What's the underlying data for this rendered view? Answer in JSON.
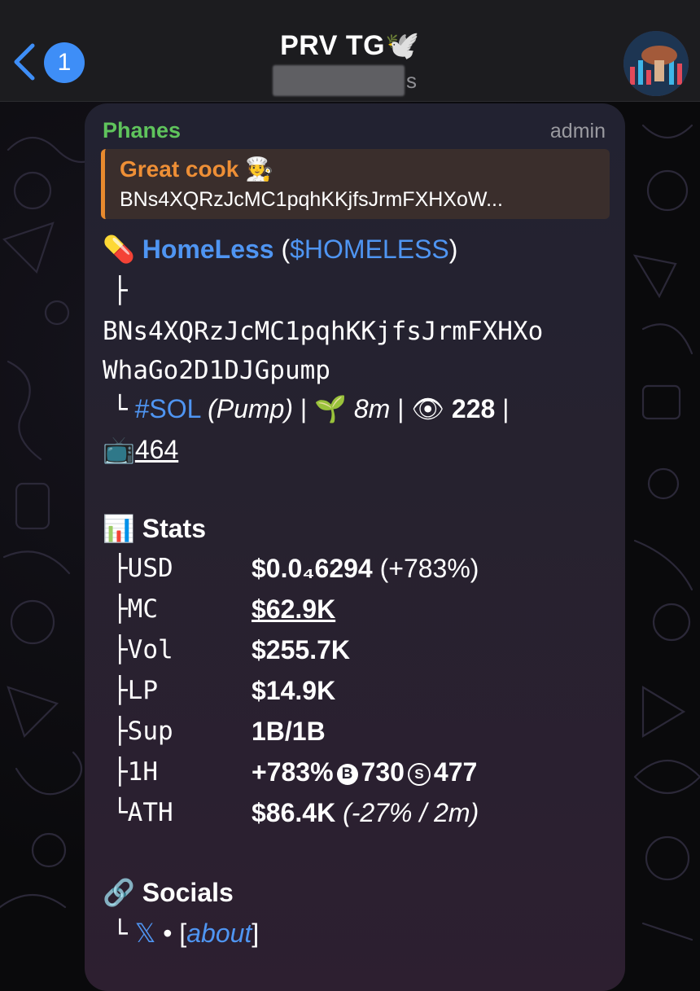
{
  "header": {
    "back_badge": "1",
    "title": "PRV TG",
    "title_emoji": "🕊️",
    "subtitle_visible_suffix": "s"
  },
  "message": {
    "sender": "Phanes",
    "role": "admin",
    "reply": {
      "title": "Great cook",
      "title_emoji": "🧑‍🍳",
      "text": "BNs4XQRzJcMC1pqhKKjfsJrmFXHXoW..."
    },
    "token": {
      "emoji": "💊",
      "name": "HomeLess",
      "open_paren": " (",
      "ticker": "$HOMELESS",
      "close_paren": ")",
      "tree_branch": "├",
      "address_line1": "BNs4XQRzJcMC1pqhKKjfsJrmFXHXo",
      "address_line2": "WhaGo2D1DJGpump",
      "tree_end": "└",
      "chain_tag": "#SOL",
      "platform": "(Pump)",
      "sep": " | ",
      "age_emoji": "🌱",
      "age": "8m",
      "views_emoji": "👁",
      "views": "228",
      "tv_emoji": "📺",
      "tv_count": "464"
    },
    "stats": {
      "emoji": "📊",
      "heading": "Stats",
      "rows": [
        {
          "branch": "├",
          "key": "USD",
          "value": "$0.0₄6294",
          "extra": " (+783%)"
        },
        {
          "branch": "├",
          "key": "MC",
          "value": "$62.9K",
          "extra": ""
        },
        {
          "branch": "├",
          "key": "Vol",
          "value": "$255.7K",
          "extra": ""
        },
        {
          "branch": "├",
          "key": "LP",
          "value": "$14.9K",
          "extra": ""
        },
        {
          "branch": "├",
          "key": "Sup",
          "value": "1B/1B",
          "extra": ""
        },
        {
          "branch": "├",
          "key": "1H",
          "value": "+783%",
          "buy_icon": "B",
          "buys": "730",
          "sell_icon": "S",
          "sells": "477"
        },
        {
          "branch": "└",
          "key": "ATH",
          "value": "$86.4K",
          "extra": " (-27% / 2m)"
        }
      ]
    },
    "socials": {
      "emoji": "🔗",
      "heading": "Socials",
      "branch": "└",
      "x_icon": "𝕏",
      "dot": " • ",
      "about_open": "[",
      "about": "about",
      "about_close": "]"
    }
  }
}
